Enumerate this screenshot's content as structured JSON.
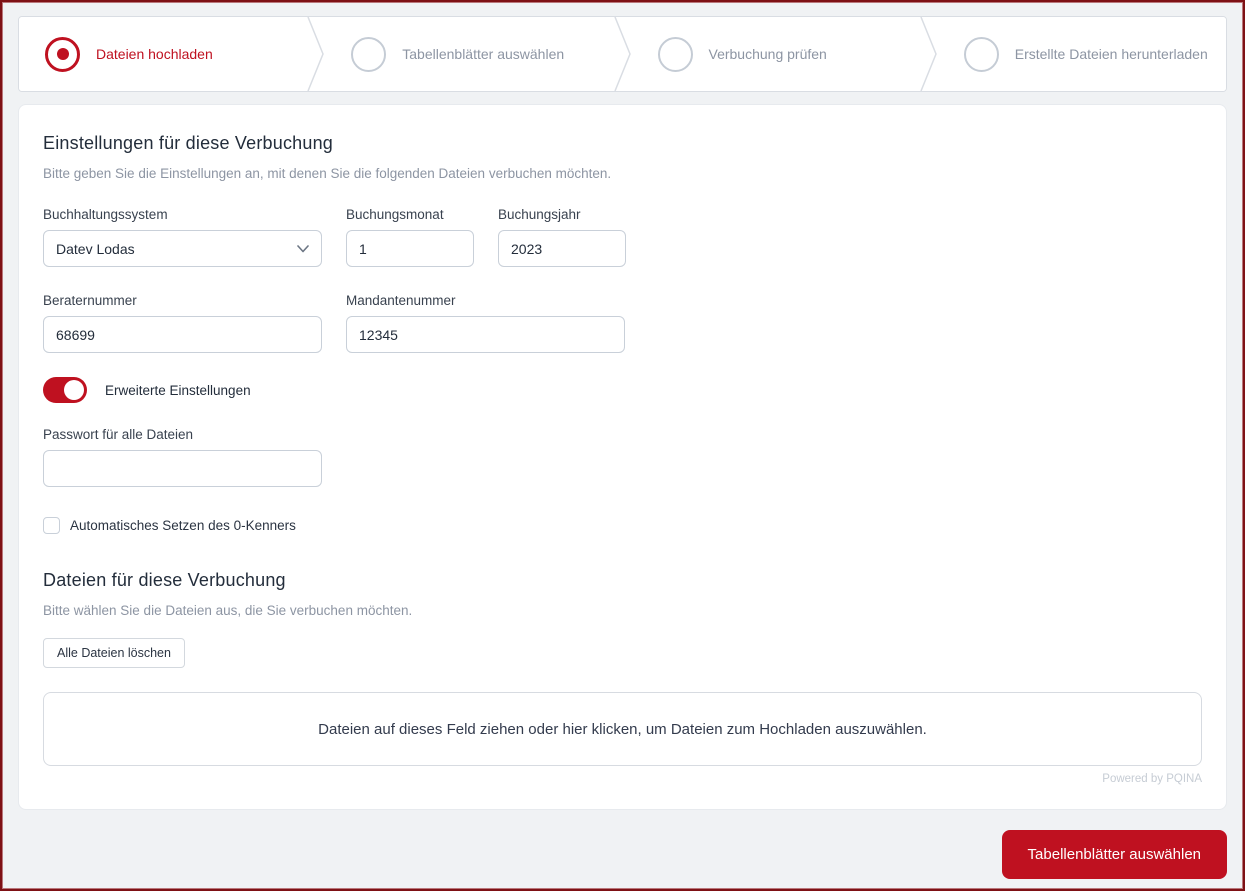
{
  "colors": {
    "accent_red": "#bf1120",
    "frame_border": "#7e1115",
    "background": "#f0f2f4",
    "muted_text": "#8d95a3",
    "dark_text": "#232d3b"
  },
  "icons": {
    "select_chevron": "chevron-down-icon",
    "active_step": "radio-dot-icon"
  },
  "stepper": {
    "steps": [
      {
        "label": "Dateien hochladen",
        "state": "active"
      },
      {
        "label": "Tabellenblätter auswählen",
        "state": "inactive"
      },
      {
        "label": "Verbuchung prüfen",
        "state": "inactive"
      },
      {
        "label": "Erstellte Dateien herunterladen",
        "state": "inactive"
      }
    ]
  },
  "settings_section": {
    "title": "Einstellungen für diese Verbuchung",
    "subtitle": "Bitte geben Sie die Einstellungen an, mit denen Sie die folgenden Dateien verbuchen möchten.",
    "fields": {
      "accounting_system": {
        "label": "Buchhaltungssystem",
        "value": "Datev Lodas"
      },
      "booking_month": {
        "label": "Buchungsmonat",
        "value": "1"
      },
      "booking_year": {
        "label": "Buchungsjahr",
        "value": "2023"
      },
      "consultant_number": {
        "label": "Beraternummer",
        "value": "68699"
      },
      "client_number": {
        "label": "Mandantenummer",
        "value": "12345"
      },
      "password": {
        "label": "Passwort für alle Dateien",
        "value": ""
      }
    },
    "advanced_toggle": {
      "label": "Erweiterte Einstellungen",
      "state": "on"
    },
    "zero_flag_checkbox": {
      "label": "Automatisches Setzen des 0-Kenners",
      "checked": false
    }
  },
  "files_section": {
    "title": "Dateien für diese Verbuchung",
    "subtitle": "Bitte wählen Sie die Dateien aus, die Sie verbuchen möchten.",
    "delete_all_label": "Alle Dateien löschen",
    "dropzone_text": "Dateien auf dieses Feld ziehen oder hier klicken, um Dateien zum Hochladen auszuwählen.",
    "powered_by": "Powered by PQINA"
  },
  "footer": {
    "next_label": "Tabellenblätter auswählen"
  }
}
